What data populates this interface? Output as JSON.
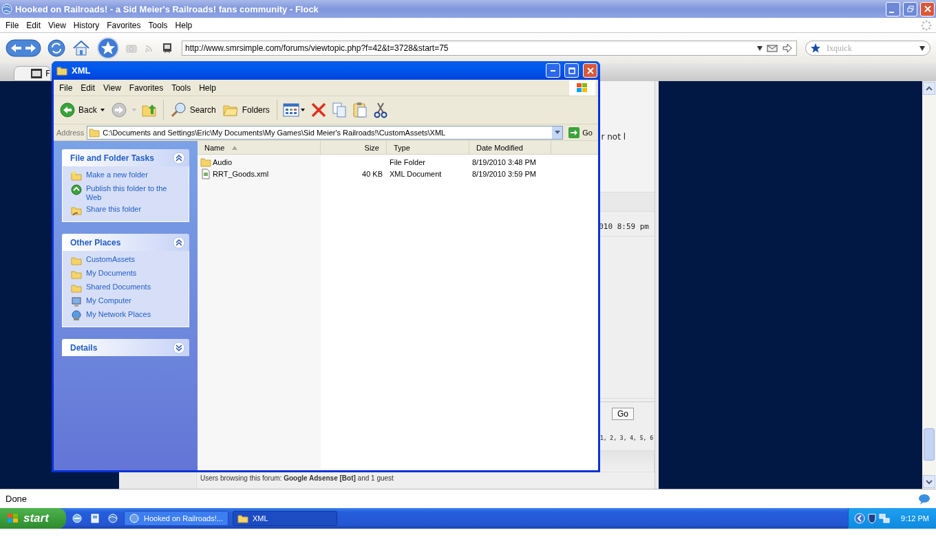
{
  "browser": {
    "title": "Hooked on Railroads! - a Sid Meier's Railroads! fans community - Flock",
    "menu": [
      "File",
      "Edit",
      "View",
      "History",
      "Favorites",
      "Tools",
      "Help"
    ],
    "address": "http://www.smrsimple.com/forums/viewtopic.php?f=42&t=3728&start=75",
    "search_placeholder": "Ixquick",
    "tab_label": "F",
    "status": "Done"
  },
  "forum": {
    "fragment_1": "r not l",
    "post_time": "010 8:59 pm",
    "go_button": "Go",
    "pages": "1, 2, 3, 4, 5, **6**",
    "online": "Users browsing this forum: **Google Adsense [Bot]** and 1 guest"
  },
  "explorer": {
    "title": "XML",
    "menu": [
      "File",
      "Edit",
      "View",
      "Favorites",
      "Tools",
      "Help"
    ],
    "toolbar": {
      "back": "Back",
      "search": "Search",
      "folders": "Folders"
    },
    "address_label": "Address",
    "address": "C:\\Documents and Settings\\Eric\\My Documents\\My Games\\Sid Meier's Railroads!\\CustomAssets\\XML",
    "go": "Go",
    "panels": [
      {
        "title": "File and Folder Tasks",
        "expanded": true,
        "items": [
          {
            "label": "Make a new folder",
            "kind": "new-folder"
          },
          {
            "label": "Publish this folder to the Web",
            "kind": "publish"
          },
          {
            "label": "Share this folder",
            "kind": "share"
          }
        ]
      },
      {
        "title": "Other Places",
        "expanded": true,
        "items": [
          {
            "label": "CustomAssets",
            "kind": "folder"
          },
          {
            "label": "My Documents",
            "kind": "folder"
          },
          {
            "label": "Shared Documents",
            "kind": "folder"
          },
          {
            "label": "My Computer",
            "kind": "computer"
          },
          {
            "label": "My Network Places",
            "kind": "network"
          }
        ]
      },
      {
        "title": "Details",
        "expanded": false
      }
    ],
    "columns": [
      {
        "label": "Name",
        "sorted": true
      },
      {
        "label": "Size",
        "sorted": false
      },
      {
        "label": "Type",
        "sorted": false
      },
      {
        "label": "Date Modified",
        "sorted": false
      }
    ],
    "files": [
      {
        "name": "Audio",
        "type": "File Folder",
        "modified": "8/19/2010 3:48 PM",
        "kind": "folder"
      },
      {
        "name": "RRT_Goods.xml",
        "size": "40 KB",
        "type": "XML Document",
        "modified": "8/19/2010 3:59 PM",
        "kind": "xml"
      }
    ]
  },
  "taskbar": {
    "start": "start",
    "tasks": [
      {
        "label": "Hooked on Railroads!...",
        "selected": false,
        "kind": "browser"
      },
      {
        "label": "XML",
        "selected": true,
        "kind": "folder"
      }
    ],
    "clock": "9:12 PM"
  }
}
